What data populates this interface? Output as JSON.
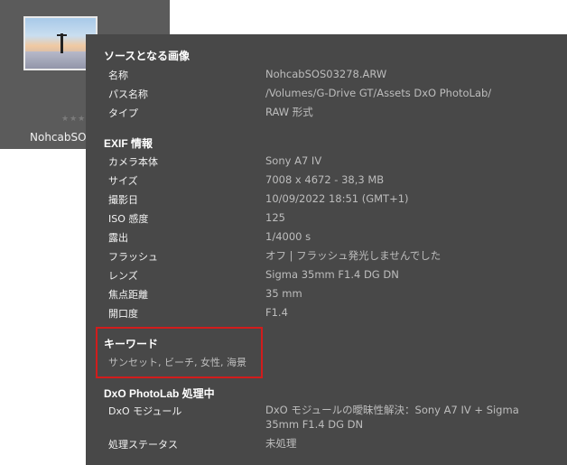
{
  "thumbnail": {
    "name": "NohcabSOS",
    "stars": "★★★★★"
  },
  "source_section": {
    "title": "ソースとなる画像",
    "rows": [
      {
        "label": "名称",
        "value": "NohcabSOS03278.ARW"
      },
      {
        "label": "パス名称",
        "value": "/Volumes/G-Drive GT/Assets DxO PhotoLab/"
      },
      {
        "label": "タイプ",
        "value": "RAW 形式"
      }
    ]
  },
  "exif_section": {
    "title": "EXIF 情報",
    "rows": [
      {
        "label": "カメラ本体",
        "value": "Sony A7 IV"
      },
      {
        "label": "サイズ",
        "value": "7008 x 4672 - 38,3 MB"
      },
      {
        "label": "撮影日",
        "value": "10/09/2022 18:51 (GMT+1)"
      },
      {
        "label": "ISO 感度",
        "value": "125"
      },
      {
        "label": "露出",
        "value": "1/4000 s"
      },
      {
        "label": "フラッシュ",
        "value": "オフ | フラッシュ発光しませんでした"
      },
      {
        "label": "レンズ",
        "value": "Sigma 35mm F1.4 DG DN"
      },
      {
        "label": "焦点距離",
        "value": "35 mm"
      },
      {
        "label": "開口度",
        "value": "F1.4"
      }
    ]
  },
  "keywords_section": {
    "title": "キーワード",
    "value": "サンセット, ビーチ, 女性, 海景",
    "highlight_color": "#d21c1c"
  },
  "processing_section": {
    "title": "DxO PhotoLab 処理中",
    "rows": [
      {
        "label": "DxO モジュール",
        "value": "DxO モジュールの曖昧性解決：Sony A7 IV + Sigma 35mm F1.4 DG DN"
      },
      {
        "label": "処理ステータス",
        "value": "未処理"
      }
    ]
  }
}
